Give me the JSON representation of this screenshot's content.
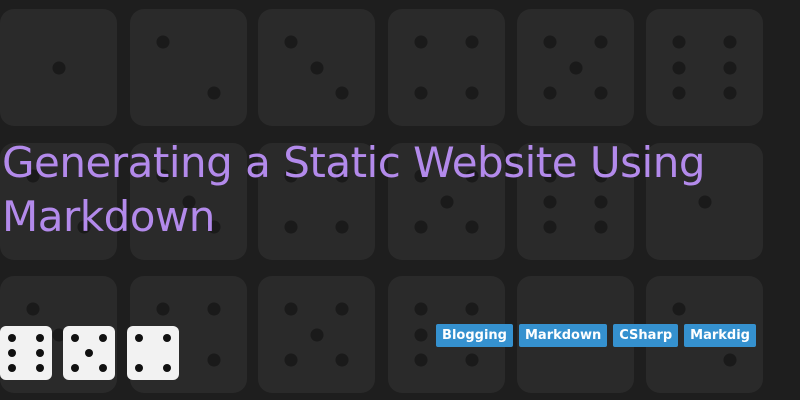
{
  "post": {
    "title": "Generating a Static Website Using Markdown",
    "tags": [
      "Blogging",
      "Markdown",
      "CSharp",
      "Markdig"
    ]
  },
  "colors": {
    "background": "#1e1e1e",
    "die_background": "#2a2a2a",
    "title": "#b38aeb",
    "tag_background": "#3591cf",
    "tag_text": "#ffffff",
    "logo_die": "#f2f2f2"
  },
  "icons": {
    "background_pattern": "dice-pattern-icon",
    "logo": "dice-logo-icon"
  }
}
